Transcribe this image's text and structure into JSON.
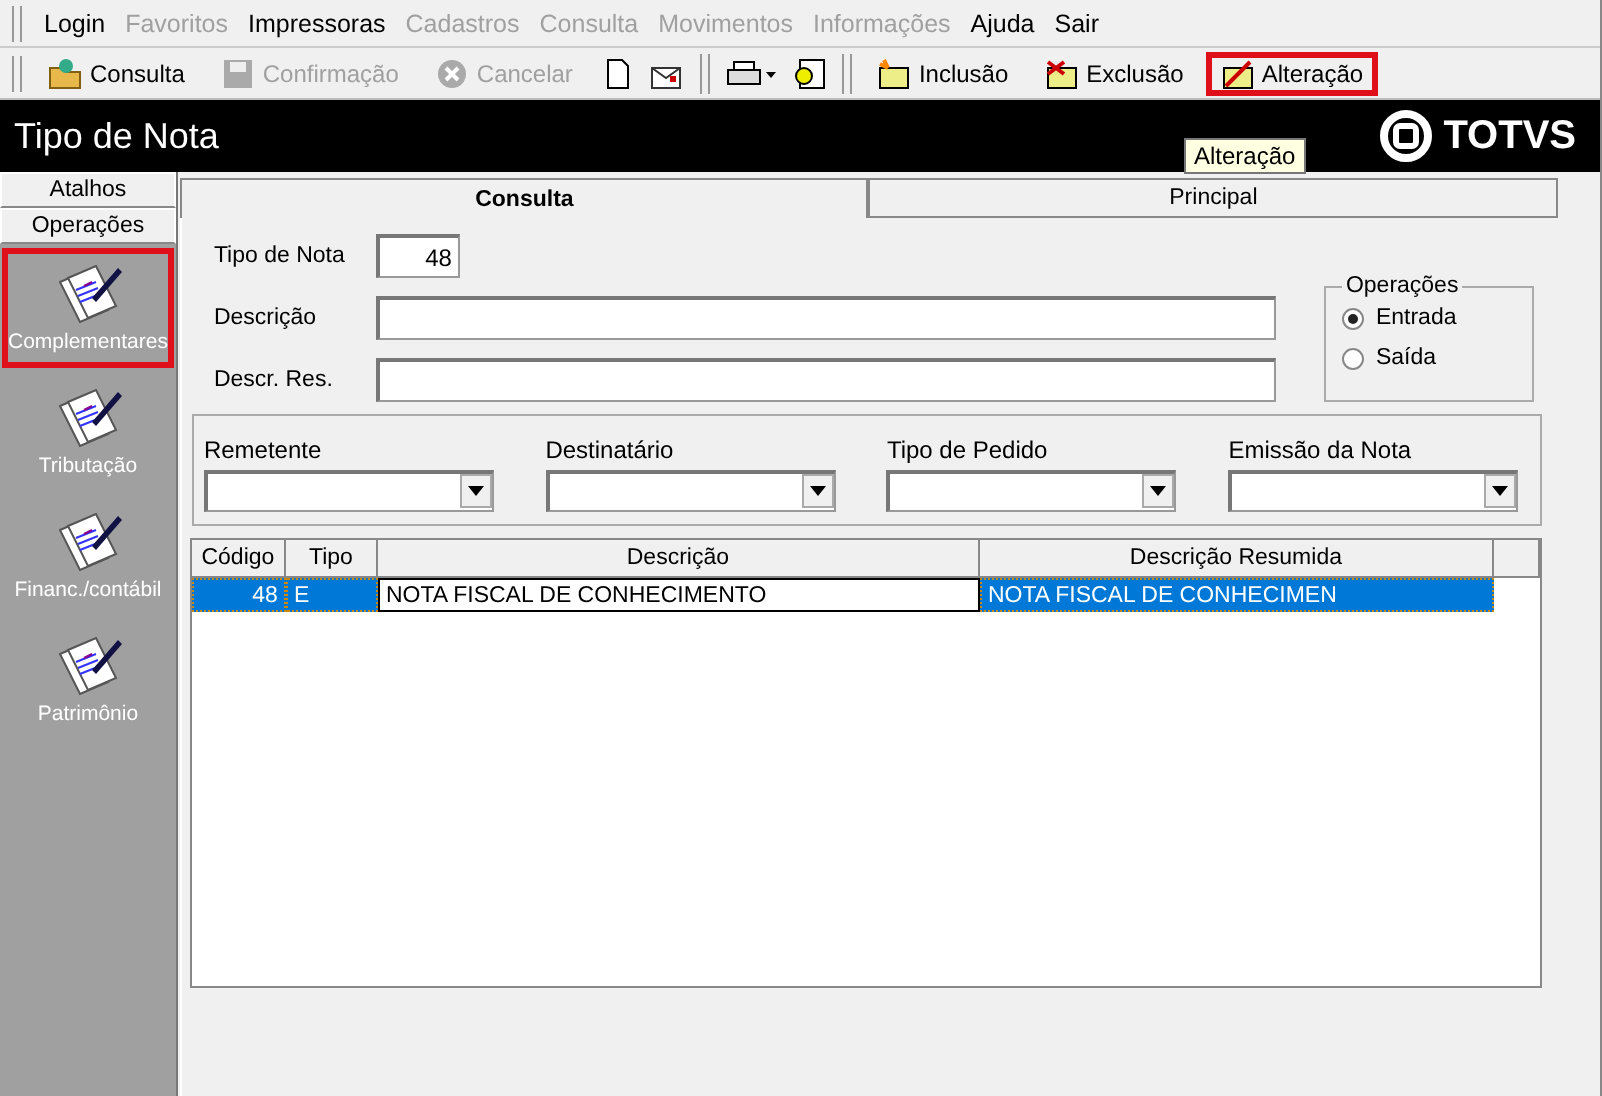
{
  "menu": [
    {
      "label": "Login",
      "disabled": false
    },
    {
      "label": "Favoritos",
      "disabled": true
    },
    {
      "label": "Impressoras",
      "disabled": false
    },
    {
      "label": "Cadastros",
      "disabled": true
    },
    {
      "label": "Consulta",
      "disabled": true
    },
    {
      "label": "Movimentos",
      "disabled": true
    },
    {
      "label": "Informações",
      "disabled": true
    },
    {
      "label": "Ajuda",
      "disabled": false
    },
    {
      "label": "Sair",
      "disabled": false
    }
  ],
  "toolbar": [
    {
      "kind": "button",
      "label": "Consulta",
      "disabled": false,
      "highlighted": false
    },
    {
      "kind": "button",
      "label": "Confirmação",
      "disabled": true,
      "highlighted": false
    },
    {
      "kind": "button",
      "label": "Cancelar",
      "disabled": true,
      "highlighted": false
    },
    {
      "kind": "icon"
    },
    {
      "kind": "icon"
    },
    {
      "kind": "separator"
    },
    {
      "kind": "icon"
    },
    {
      "kind": "icon"
    },
    {
      "kind": "separator"
    },
    {
      "kind": "button",
      "label": "Inclusão",
      "disabled": false,
      "highlighted": false
    },
    {
      "kind": "button",
      "label": "Exclusão",
      "disabled": false,
      "highlighted": false
    },
    {
      "kind": "button",
      "label": "Alteração",
      "disabled": false,
      "highlighted": true
    }
  ],
  "tooltip": "Alteração",
  "window": {
    "title": "Tipo de Nota",
    "logo": "TOTVS"
  },
  "sidebar": {
    "sections": [
      "Atalhos",
      "Operações"
    ],
    "items": [
      {
        "label": "Complementares",
        "highlighted": true
      },
      {
        "label": "Tributação",
        "highlighted": false
      },
      {
        "label": "Financ./contábil",
        "highlighted": false
      },
      {
        "label": "Patrimônio",
        "highlighted": false
      }
    ]
  },
  "tabs": [
    {
      "label": "Consulta",
      "selected": true
    },
    {
      "label": "Principal",
      "selected": false
    }
  ],
  "form": {
    "fields": [
      {
        "label": "Tipo de Nota",
        "value": "48",
        "kind": "short"
      },
      {
        "label": "Descrição",
        "kind": "long"
      },
      {
        "label": "Descr. Res.",
        "kind": "long"
      }
    ],
    "operacoes": {
      "title": "Operações",
      "options": [
        {
          "label": "Entrada",
          "selected": true
        },
        {
          "label": "Saída",
          "selected": false
        }
      ]
    },
    "filters": [
      "Remetente",
      "Destinatário",
      "Tipo de Pedido",
      "Emissão da Nota"
    ]
  },
  "table": {
    "columns": [
      "Código",
      "Tipo",
      "Descrição",
      "Descrição Resumida"
    ],
    "rows": [
      {
        "selected": true,
        "cells": [
          {
            "text": "48",
            "focused": false
          },
          {
            "text": "E",
            "focused": false
          },
          {
            "text": "NOTA FISCAL DE CONHECIMENTO",
            "focused": true
          },
          {
            "text": "NOTA FISCAL DE CONHECIMEN",
            "focused": false
          }
        ]
      }
    ]
  }
}
